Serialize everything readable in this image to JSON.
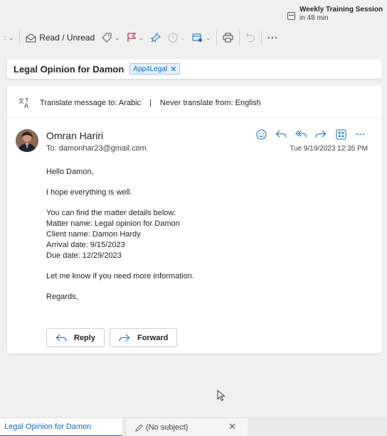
{
  "reminder": {
    "title": "Weekly Training Session",
    "subtitle": "in 48 min",
    "icon": "calendar-icon"
  },
  "toolbar": {
    "read_unread_label": "Read / Unread",
    "more_label": "···"
  },
  "message": {
    "subject": "Legal Opinion for Damon",
    "tag_label": "App4Legal",
    "translate_text": "Translate message to: Arabic",
    "never_translate_text": "Never translate from: English",
    "translate_separator": "|",
    "sender_name": "Omran Hariri",
    "to_line": "To:  damonhar23@gmail.com",
    "date": "Tue 9/19/2023 12:35 PM",
    "body": {
      "greeting": "Hello Damon,",
      "line1": "I hope everything is well.",
      "line2": "You can find the matter details below:",
      "line3": "Matter name: Legal opinion for Damon",
      "line4": "Client name: Damon Hardy",
      "line5": "Arrival date: 9/15/2023",
      "line6": "Due date: 12/29/2023",
      "line7": "Let me know if you need more information.",
      "closing": "Regards,"
    },
    "reply_label": "Reply",
    "forward_label": "Forward"
  },
  "tabs": {
    "active_tab": "Legal Opinion for Damon",
    "draft_tab": "(No subject)"
  },
  "colors": {
    "accent": "#0f6cbd",
    "flag": "#c4314b"
  }
}
